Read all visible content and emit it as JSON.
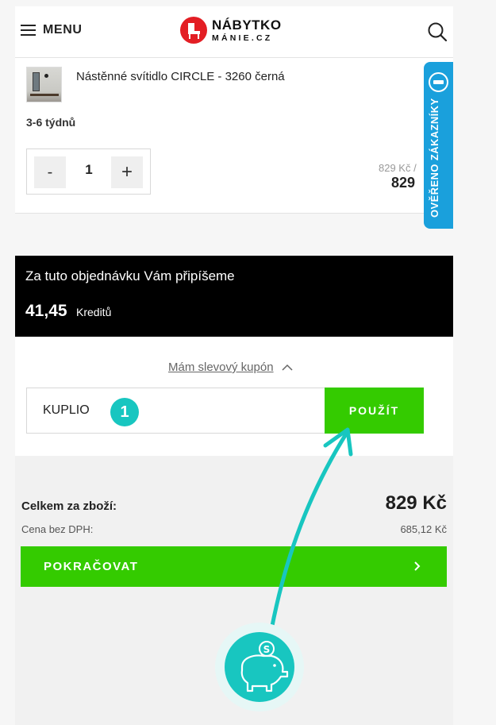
{
  "header": {
    "menu_label": "MENU",
    "logo_line1": "NÁBYTKO",
    "logo_line2": "MÁNIE.CZ"
  },
  "product": {
    "name": "Nástěnné svítidlo CIRCLE - 3260 černá",
    "delivery": "3-6 týdnů",
    "quantity": "1",
    "qty_minus": "-",
    "qty_plus": "+",
    "unit_price": "829 Kč /",
    "total_price": "829"
  },
  "verified_badge": {
    "label": "OVĚŘENO ZÁKAZNÍKY"
  },
  "credits": {
    "text": "Za tuto objednávku Vám připíšeme",
    "amount": "41,45",
    "unit": "Kreditů"
  },
  "coupon": {
    "toggle_label": "Mám slevový kupón",
    "input_value": "KUPLIO",
    "step_number": "1",
    "apply_label": "POUŽÍT"
  },
  "summary": {
    "total_label": "Celkem za zboží:",
    "total_value": "829 Kč",
    "net_label": "Cena bez DPH:",
    "net_value": "685,12 Kč",
    "continue_label": "POKRAČOVAT"
  },
  "colors": {
    "accent_green": "#34cb00",
    "brand_red": "#e31e24",
    "verified_blue": "#1aa0dc",
    "annotation_teal": "#18c6c0"
  },
  "icons": [
    "hamburger-icon",
    "search-icon",
    "chevron-up-icon",
    "chevron-right-icon",
    "piggy-bank-icon",
    "arrow-annotation"
  ]
}
